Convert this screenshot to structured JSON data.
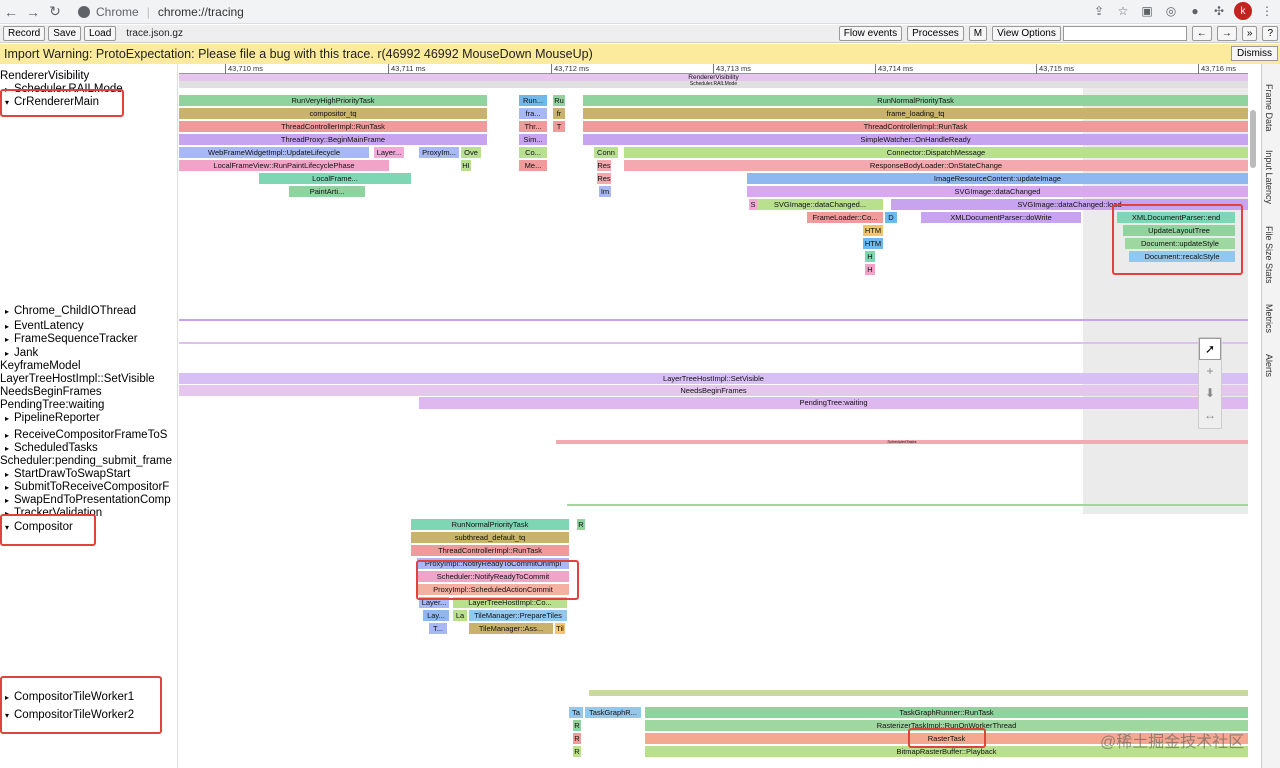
{
  "browser": {
    "tab_site": "Chrome",
    "url": "chrome://tracing",
    "avatar_letter": "k"
  },
  "toolbar": {
    "record": "Record",
    "save": "Save",
    "load": "Load",
    "filename": "trace.json.gz",
    "flow_events": "Flow events",
    "processes": "Processes",
    "m": "M",
    "view_options": "View Options",
    "prev": "←",
    "next": "→",
    "more": "»",
    "help": "?"
  },
  "warning": {
    "text": "Import Warning: ProtoExpectation: Please file a bug with this trace. r(46992 46992 MouseDown MouseUp)",
    "dismiss": "Dismiss"
  },
  "ruler": [
    "43,710 ms",
    "43,711 ms",
    "43,712 ms",
    "43,713 ms",
    "43,714 ms",
    "43,715 ms",
    "43,716 ms"
  ],
  "tracks": [
    {
      "label": "RendererVisibility",
      "arrow": ""
    },
    {
      "label": "Scheduler.RAILMode",
      "arrow": "▸"
    },
    {
      "label": "CrRendererMain",
      "arrow": "▾"
    },
    {
      "label": "Chrome_ChildIOThread",
      "arrow": "▸"
    },
    {
      "label": "EventLatency",
      "arrow": "▸"
    },
    {
      "label": "FrameSequenceTracker",
      "arrow": "▸"
    },
    {
      "label": "Jank",
      "arrow": "▸"
    },
    {
      "label": "KeyframeModel",
      "arrow": ""
    },
    {
      "label": "LayerTreeHostImpl::SetVisible",
      "arrow": ""
    },
    {
      "label": "NeedsBeginFrames",
      "arrow": ""
    },
    {
      "label": "PendingTree:waiting",
      "arrow": ""
    },
    {
      "label": "PipelineReporter",
      "arrow": "▸"
    },
    {
      "label": "ReceiveCompositorFrameToS",
      "arrow": "▸"
    },
    {
      "label": "ScheduledTasks",
      "arrow": "▸"
    },
    {
      "label": "Scheduler:pending_submit_frame",
      "arrow": ""
    },
    {
      "label": "StartDrawToSwapStart",
      "arrow": "▸"
    },
    {
      "label": "SubmitToReceiveCompositorF",
      "arrow": "▸"
    },
    {
      "label": "SwapEndToPresentationComp",
      "arrow": "▸"
    },
    {
      "label": "TrackerValidation",
      "arrow": "▸"
    },
    {
      "label": "Compositor",
      "arrow": "▾"
    },
    {
      "label": "CompositorTileWorker1",
      "arrow": "▸"
    },
    {
      "label": "CompositorTileWorker2",
      "arrow": "▾"
    }
  ],
  "slices": {
    "renderer_visibility": "RendererVisibility",
    "rail_mode": "Scheduler.RAILMode",
    "main": [
      "RunVeryHighPriorityTask",
      "compositor_tq",
      "ThreadControllerImpl::RunTask",
      "ThreadProxy::BeginMainFrame",
      "WebFrameWidgetImpl::UpdateLifecycle",
      "LocalFrameView::RunPaintLifecyclePhase",
      "LocalFrame...",
      "PaintArti...",
      "Run...",
      "fra...",
      "Thr...",
      "Sim...",
      "Co...",
      "Me...",
      "Ru",
      "fr",
      "T",
      "Layer...",
      "ProxyIm...",
      "Ove",
      "HI",
      "Res",
      "Im",
      "S",
      "RunNormalPriorityTask",
      "frame_loading_tq",
      "ThreadControllerImpl::RunTask",
      "SimpleWatcher::OnHandleReady",
      "Connector::DispatchMessage",
      "ResponseBodyLoader::OnStateChange",
      "ImageResourceContent::updateImage",
      "SVGImage::dataChanged",
      "SVGImage::dataChanged::load",
      "SVGImage::dataChanged...",
      "FrameLoader::Co...",
      "D",
      "XMLDocumentParser::doWrite",
      "HTM",
      "HTM",
      "H",
      "H",
      "Conn",
      "Res"
    ],
    "highlight_main": [
      "XMLDocumentParser::end",
      "UpdateLayoutTree",
      "Document::updateStyle",
      "Document::recalcStyle"
    ],
    "layer_tree_visible": "LayerTreeHostImpl::SetVisible",
    "needs_begin_frames": "NeedsBeginFrames",
    "pending_tree": "PendingTree:waiting",
    "scheduled_tasks": "ScheduledTasks",
    "compositor": [
      "RunNormalPriorityTask",
      "subthread_default_tq",
      "ThreadControllerImpl::RunTask",
      "Layer...",
      "LayerTreeHostImpl::Co...",
      "Lay...",
      "La",
      "TileManager::PrepareTiles",
      "T...",
      "TileManager::Ass...",
      "Til",
      "R"
    ],
    "highlight_compositor": [
      "ProxyImpl::NotifyReadyToCommitOnImpl",
      "Scheduler::NotifyReadyToCommit",
      "ProxyImpl::ScheduledActionCommit"
    ],
    "tile_worker": [
      "Ta",
      "TaskGraphR...",
      "TaskGraphRunner::RunTask",
      "RasterizerTaskImpl::RunOnWorkerThread",
      "BitmapRasterBuffer::Playback",
      "R",
      "R",
      "R"
    ],
    "raster_task": "RasterTask"
  },
  "side_tabs": [
    "Frame Data",
    "Input Latency",
    "File Size Stats",
    "Metrics",
    "Alerts"
  ],
  "watermark": "@稀土掘金技术社区"
}
